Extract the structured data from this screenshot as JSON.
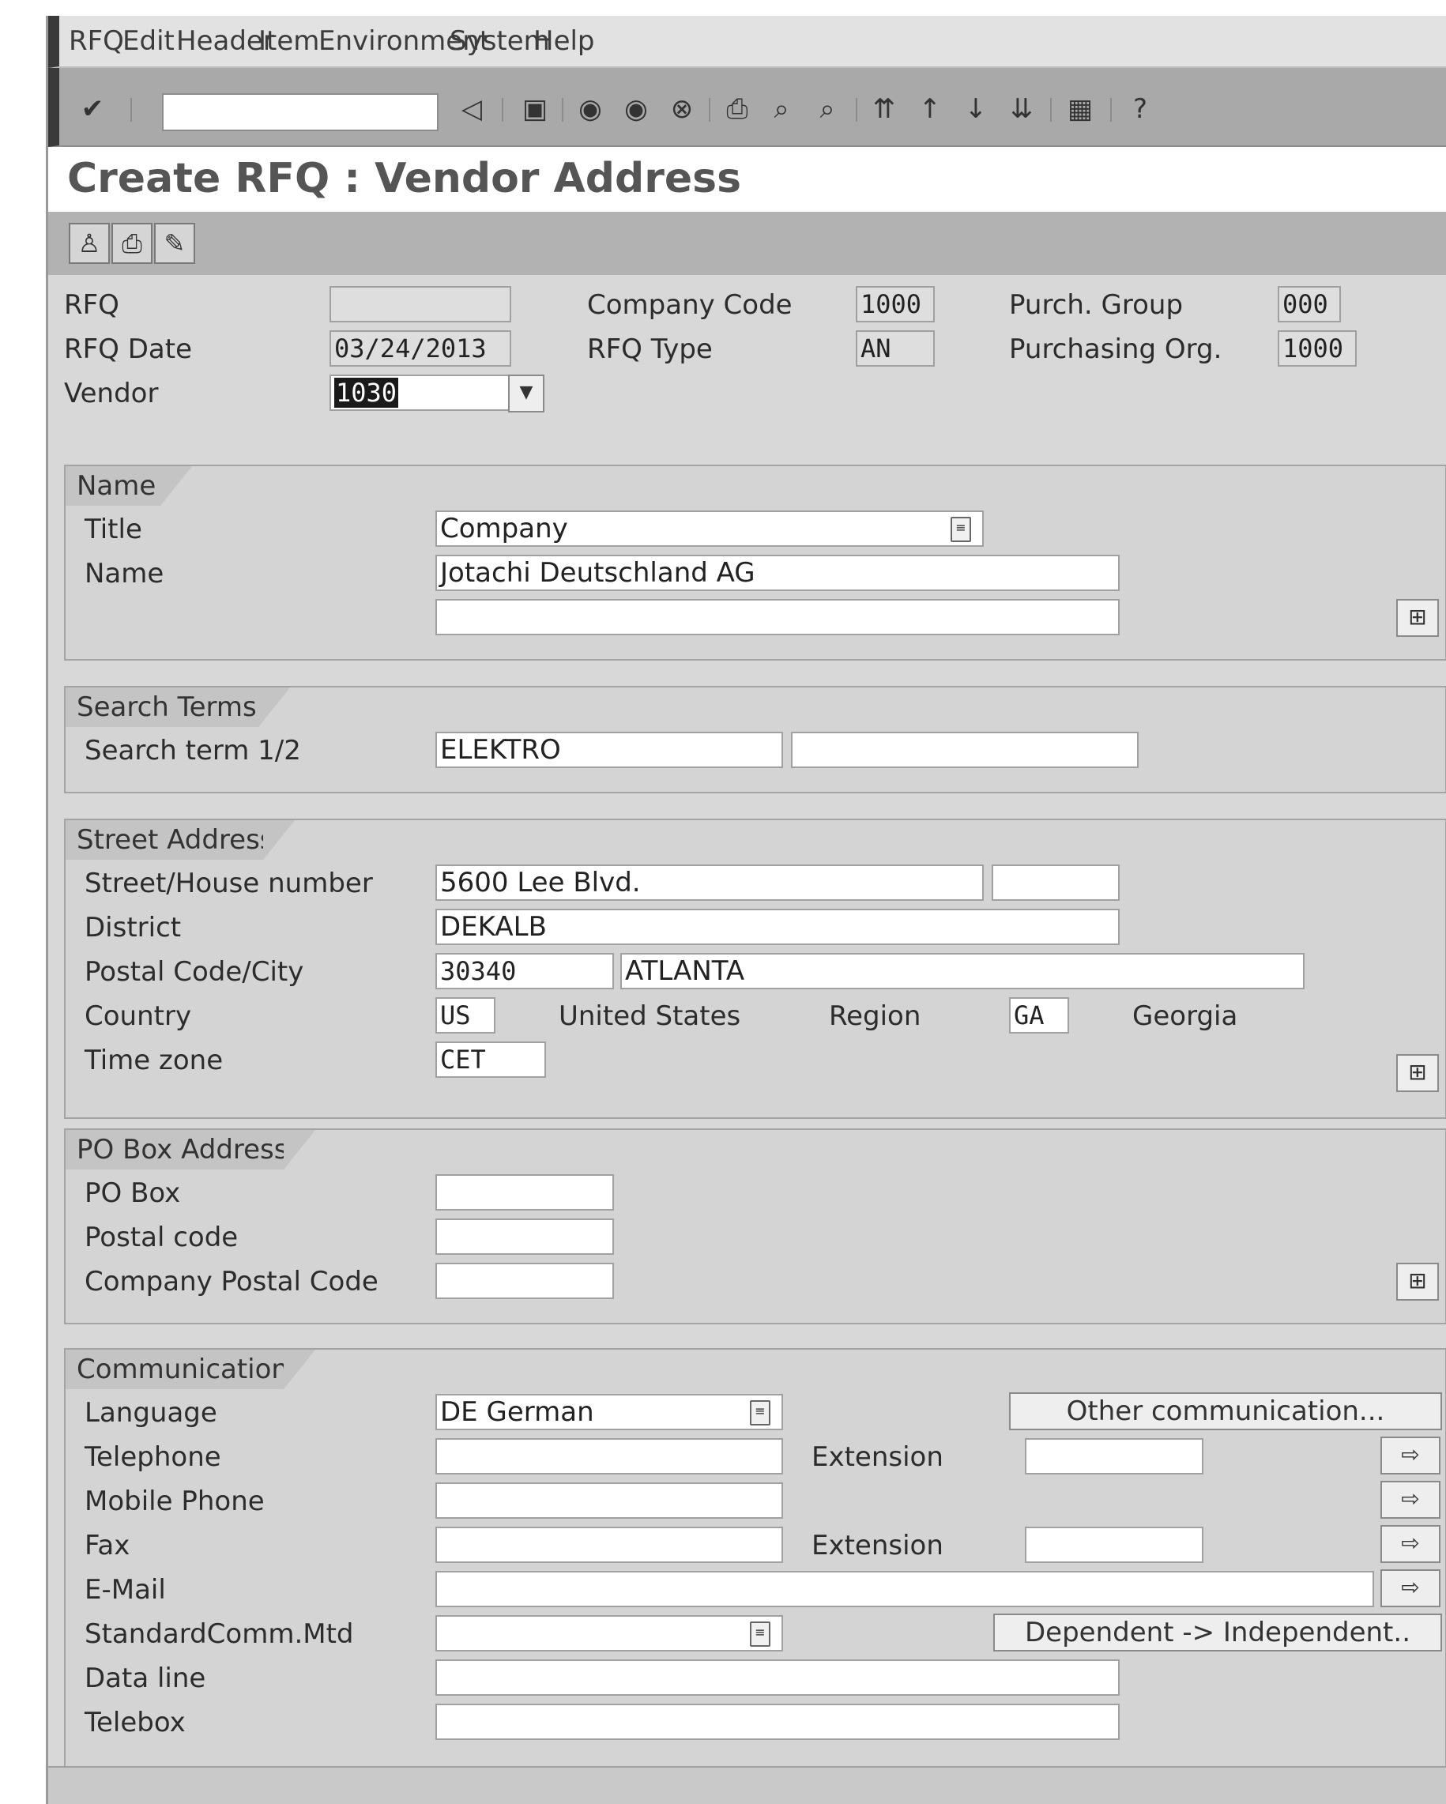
{
  "menu": [
    "RFQ",
    "Edit",
    "Header",
    "Item",
    "Environment",
    "System",
    "Help"
  ],
  "page_title": "Create RFQ : Vendor Address",
  "header": {
    "rfq_label": "RFQ",
    "rfq_value": "",
    "rfq_date_label": "RFQ Date",
    "rfq_date_value": "03/24/2013",
    "vendor_label": "Vendor",
    "vendor_value": "1030",
    "company_code_label": "Company Code",
    "company_code_value": "1000",
    "rfq_type_label": "RFQ Type",
    "rfq_type_value": "AN",
    "purch_group_label": "Purch. Group",
    "purch_group_value": "000",
    "purch_org_label": "Purchasing Org.",
    "purch_org_value": "1000"
  },
  "name_group": {
    "title": "Name",
    "title_label": "Title",
    "title_value": "Company",
    "name_label": "Name",
    "name_value": "Jotachi Deutschland AG",
    "name2_value": ""
  },
  "search_group": {
    "title": "Search Terms",
    "term_label": "Search term 1/2",
    "term1_value": "ELEKTRO",
    "term2_value": ""
  },
  "street_group": {
    "title": "Street Address",
    "street_label": "Street/House number",
    "street_value": "5600 Lee Blvd.",
    "house_value": "",
    "district_label": "District",
    "district_value": "DEKALB",
    "postal_label": "Postal Code/City",
    "postal_value": "30340",
    "city_value": "ATLANTA",
    "country_label": "Country",
    "country_value": "US",
    "country_name": "United States",
    "region_label": "Region",
    "region_value": "GA",
    "region_name": "Georgia",
    "timezone_label": "Time zone",
    "timezone_value": "CET"
  },
  "pobox_group": {
    "title": "PO Box Address",
    "pobox_label": "PO Box",
    "postal_label": "Postal code",
    "company_postal_label": "Company Postal Code"
  },
  "comm_group": {
    "title": "Communication",
    "language_label": "Language",
    "language_value": "DE  German",
    "other_comm_button": "Other communication...",
    "telephone_label": "Telephone",
    "extension_label": "Extension",
    "mobile_label": "Mobile Phone",
    "fax_label": "Fax",
    "fax_extension_label": "Extension",
    "email_label": "E-Mail",
    "stdcomm_label": "StandardComm.Mtd",
    "dependent_button": "Dependent -> Independent..",
    "dataline_label": "Data line",
    "telebox_label": "Telebox"
  }
}
